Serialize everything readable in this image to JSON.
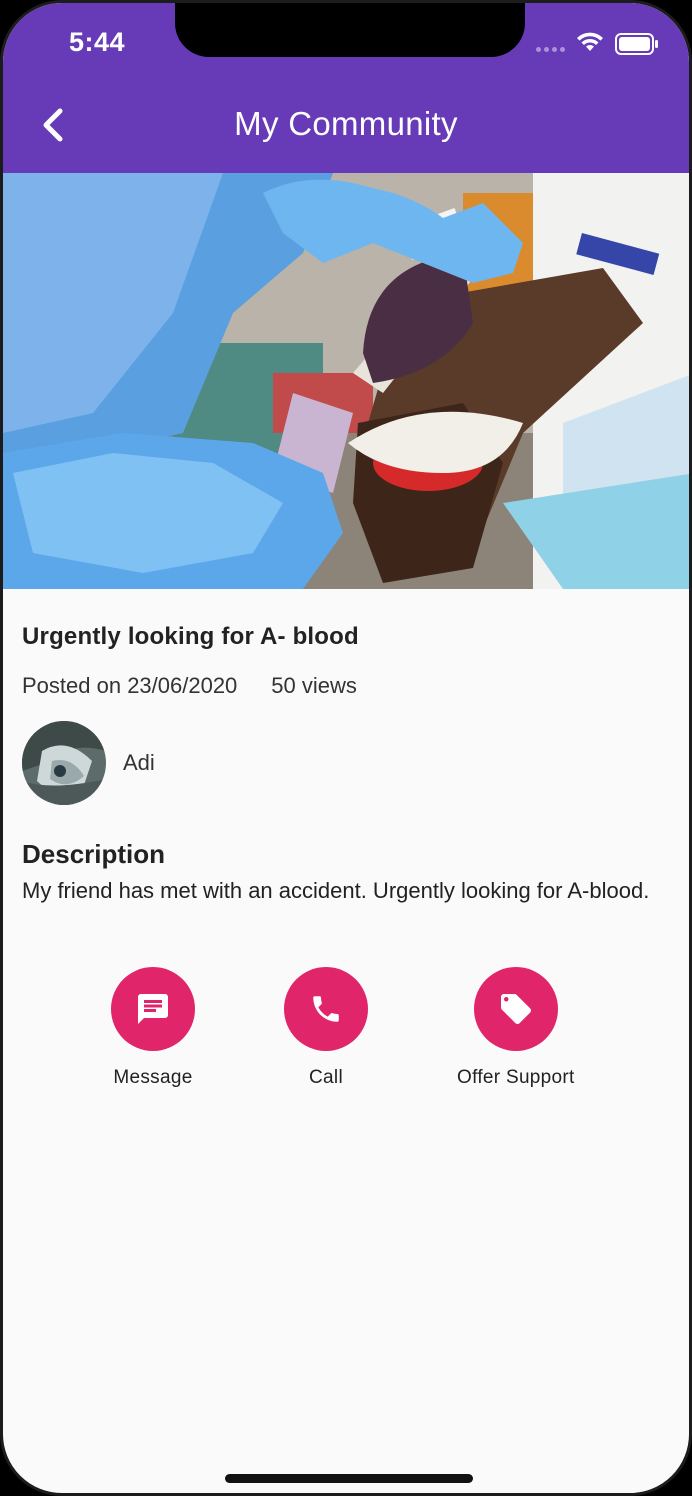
{
  "status_bar": {
    "time": "5:44"
  },
  "header": {
    "title": "My Community",
    "back_icon": "chevron-left-icon",
    "background": "#673ab7"
  },
  "post": {
    "title": "Urgently looking for A- blood",
    "posted_on": "Posted on 23/06/2020",
    "views": "50 views",
    "author": {
      "name": "Adi"
    },
    "description_heading": "Description",
    "description": "My friend has met with an accident. Urgently looking for A-blood."
  },
  "actions": [
    {
      "label": "Message",
      "icon": "message-icon"
    },
    {
      "label": "Call",
      "icon": "phone-icon"
    },
    {
      "label": "Offer Support",
      "icon": "tag-icon"
    }
  ],
  "colors": {
    "accent": "#e0256a",
    "primary": "#673ab7"
  }
}
